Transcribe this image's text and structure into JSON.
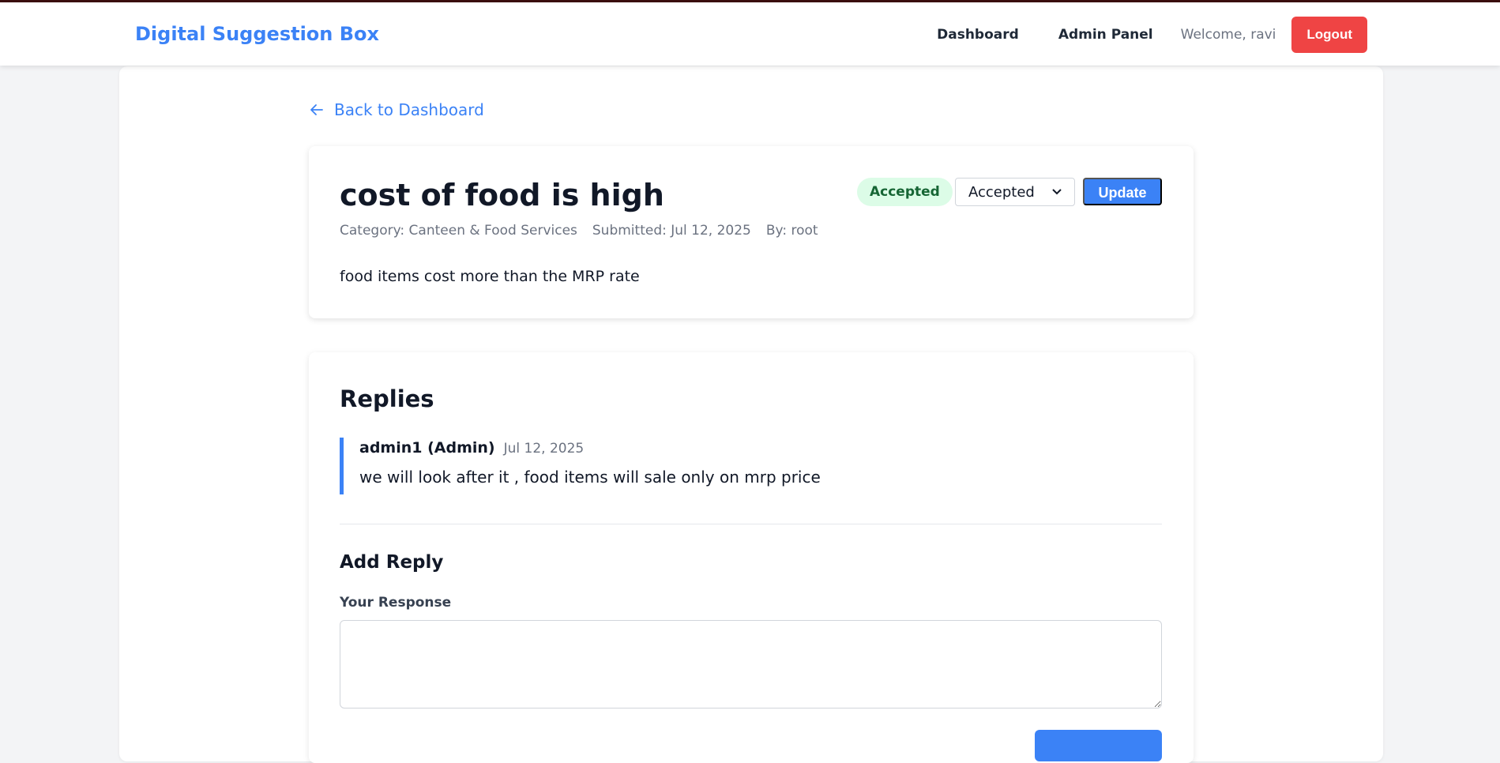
{
  "nav": {
    "brand": "Digital Suggestion Box",
    "links": [
      "Dashboard",
      "Admin Panel"
    ],
    "welcome": "Welcome, ravi",
    "logout": "Logout"
  },
  "back_link": "Back to Dashboard",
  "suggestion": {
    "title": "cost of food is high",
    "category": "Category: Canteen & Food Services",
    "submitted": "Submitted: Jul 12, 2025",
    "by": "By: root",
    "description": "food items cost more than the MRP rate",
    "status_badge": "Accepted",
    "status_select": "Accepted",
    "update_label": "Update"
  },
  "replies": {
    "title": "Replies",
    "items": [
      {
        "author": "admin1 (Admin)",
        "date": "Jul 12, 2025",
        "text": "we will look after it , food items will sale only on mrp price"
      }
    ],
    "add_title": "Add Reply",
    "response_label": "Your Response",
    "response_value": ""
  },
  "colors": {
    "accent": "#3b82f6",
    "danger": "#ef4444",
    "success_bg": "#dcfce7",
    "success_text": "#166534"
  }
}
